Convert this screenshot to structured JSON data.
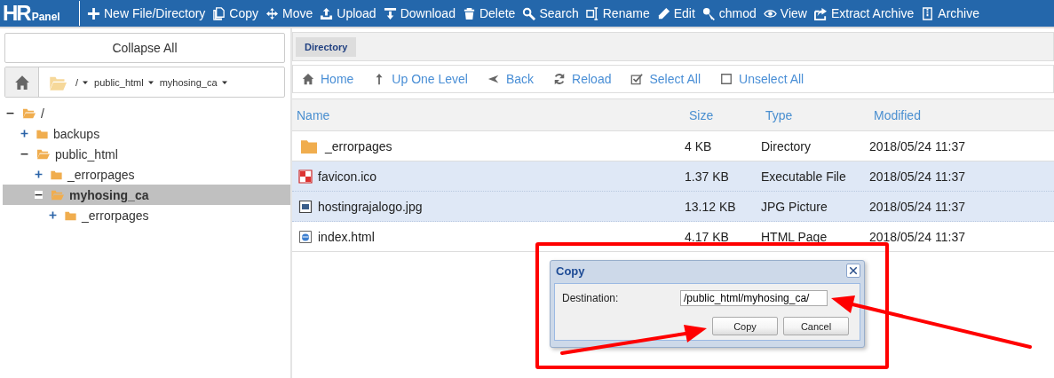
{
  "logo": {
    "main": "HR",
    "sub": "Panel"
  },
  "toolbar": [
    {
      "label": "New File/Directory"
    },
    {
      "label": "Copy"
    },
    {
      "label": "Move"
    },
    {
      "label": "Upload"
    },
    {
      "label": "Download"
    },
    {
      "label": "Delete"
    },
    {
      "label": "Search"
    },
    {
      "label": "Rename"
    },
    {
      "label": "Edit"
    },
    {
      "label": "chmod"
    },
    {
      "label": "View"
    },
    {
      "label": "Extract Archive"
    },
    {
      "label": "Archive"
    }
  ],
  "sidebar": {
    "collapse_button": "Collapse All",
    "breadcrumb": [
      {
        "label": "/"
      },
      {
        "label": "public_html"
      },
      {
        "label": "myhosing_ca"
      }
    ],
    "tree": [
      {
        "label": "/",
        "expanded": true,
        "selected": false,
        "children": [
          {
            "label": "backups",
            "expanded": false,
            "selected": false
          },
          {
            "label": "public_html",
            "expanded": true,
            "selected": false,
            "children": [
              {
                "label": "_errorpages",
                "expanded": false,
                "selected": false
              },
              {
                "label": "myhosing_ca",
                "expanded": true,
                "selected": true,
                "children": [
                  {
                    "label": "_errorpages",
                    "expanded": false,
                    "selected": false
                  }
                ]
              }
            ]
          }
        ]
      }
    ]
  },
  "tabs": [
    {
      "label": "Directory",
      "selected": true
    }
  ],
  "nav": [
    {
      "label": "Home"
    },
    {
      "label": "Up One Level"
    },
    {
      "label": "Back"
    },
    {
      "label": "Reload"
    },
    {
      "label": "Select All"
    },
    {
      "label": "Unselect All"
    }
  ],
  "table": {
    "columns": [
      "Name",
      "Size",
      "Type",
      "Modified"
    ],
    "rows": [
      {
        "kind": "folder",
        "selected": false,
        "cells": [
          "_errorpages",
          "4 KB",
          "Directory",
          "2018/05/24 11:37"
        ]
      },
      {
        "kind": "icon-file",
        "selected": true,
        "cells": [
          "favicon.ico",
          "1.37 KB",
          "Executable File",
          "2018/05/24 11:37"
        ]
      },
      {
        "kind": "image",
        "selected": true,
        "cells": [
          "hostingrajalogo.jpg",
          "13.12 KB",
          "JPG Picture",
          "2018/05/24 11:37"
        ]
      },
      {
        "kind": "html",
        "selected": false,
        "cells": [
          "index.html",
          "4.17 KB",
          "HTML Page",
          "2018/05/24 11:37"
        ]
      }
    ]
  },
  "dialog": {
    "title": "Copy",
    "label": "Destination:",
    "value": "/public_html/myhosing_ca/",
    "buttons": [
      "Copy",
      "Cancel"
    ]
  }
}
